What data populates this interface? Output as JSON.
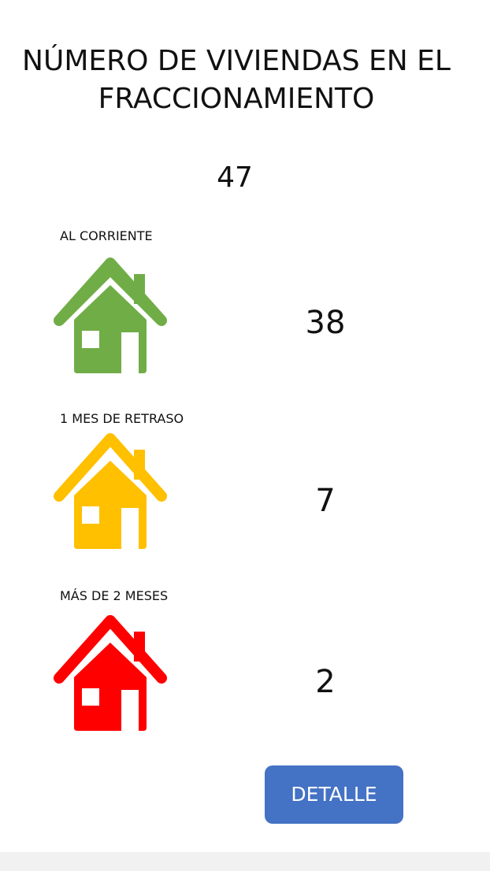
{
  "title": {
    "line1": "NÚMERO DE VIVIENDAS EN EL",
    "line2": "FRACCIONAMIENTO"
  },
  "total": "47",
  "categories": [
    {
      "label": "AL CORRIENTE",
      "count": "38",
      "color": "#70AD47",
      "icon": "house-icon"
    },
    {
      "label": "1 MES DE RETRASO",
      "count": "7",
      "color": "#FFC000",
      "icon": "house-icon"
    },
    {
      "label": "MÁS DE 2 MESES",
      "count": "2",
      "color": "#FF0000",
      "icon": "house-icon"
    }
  ],
  "detail_button": {
    "label": "DETALLE",
    "color": "#4472C4"
  }
}
